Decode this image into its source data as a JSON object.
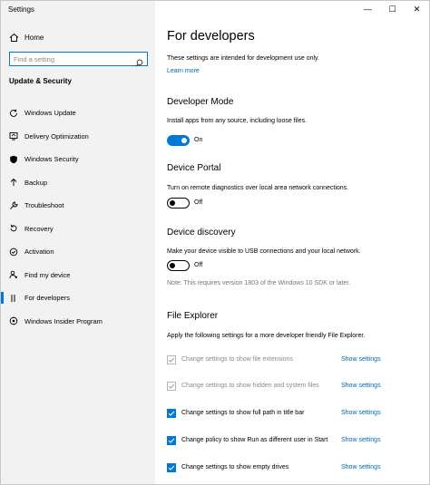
{
  "window": {
    "title": "Settings",
    "minimize_glyph": "—",
    "maximize_glyph": "☐",
    "close_glyph": "✕"
  },
  "sidebar": {
    "home_label": "Home",
    "search_placeholder": "Find a setting",
    "section_title": "Update & Security",
    "items": [
      {
        "label": "Windows Update",
        "icon": "refresh-icon"
      },
      {
        "label": "Delivery Optimization",
        "icon": "delivery-optimization-icon"
      },
      {
        "label": "Windows Security",
        "icon": "shield-icon"
      },
      {
        "label": "Backup",
        "icon": "backup-arrow-icon"
      },
      {
        "label": "Troubleshoot",
        "icon": "wrench-icon"
      },
      {
        "label": "Recovery",
        "icon": "recovery-icon"
      },
      {
        "label": "Activation",
        "icon": "check-circle-icon"
      },
      {
        "label": "Find my device",
        "icon": "person-pin-icon"
      },
      {
        "label": "For developers",
        "icon": "developer-tools-icon",
        "active": true
      },
      {
        "label": "Windows Insider Program",
        "icon": "insider-icon"
      }
    ]
  },
  "main": {
    "title": "For developers",
    "intro": "These settings are intended for development use only.",
    "learn_more": "Learn more",
    "developer_mode": {
      "heading": "Developer Mode",
      "description": "Install apps from any source, including loose files.",
      "state": "On"
    },
    "device_portal": {
      "heading": "Device Portal",
      "description": "Turn on remote diagnostics over local area network connections.",
      "state": "Off"
    },
    "device_discovery": {
      "heading": "Device discovery",
      "description": "Make your device visible to USB connections and your local network.",
      "state": "Off",
      "note": "Note: This requires version 1803 of the Windows 10 SDK or later."
    },
    "file_explorer": {
      "heading": "File Explorer",
      "description": "Apply the following settings for a more developer friendly File Explorer.",
      "show_settings_label": "Show settings",
      "options": [
        {
          "label": "Change settings to show file extensions",
          "checked": true,
          "disabled": true
        },
        {
          "label": "Change settings to show hidden and system files",
          "checked": true,
          "disabled": true
        },
        {
          "label": "Change settings to show full path in title bar",
          "checked": true,
          "disabled": false
        },
        {
          "label": "Change policy to show Run as different user in Start",
          "checked": true,
          "disabled": false
        },
        {
          "label": "Change settings to show empty drives",
          "checked": true,
          "disabled": false
        }
      ]
    }
  },
  "colors": {
    "accent": "#0078d7",
    "link": "#0067b8",
    "sidebar_bg": "#f2f2f2"
  }
}
